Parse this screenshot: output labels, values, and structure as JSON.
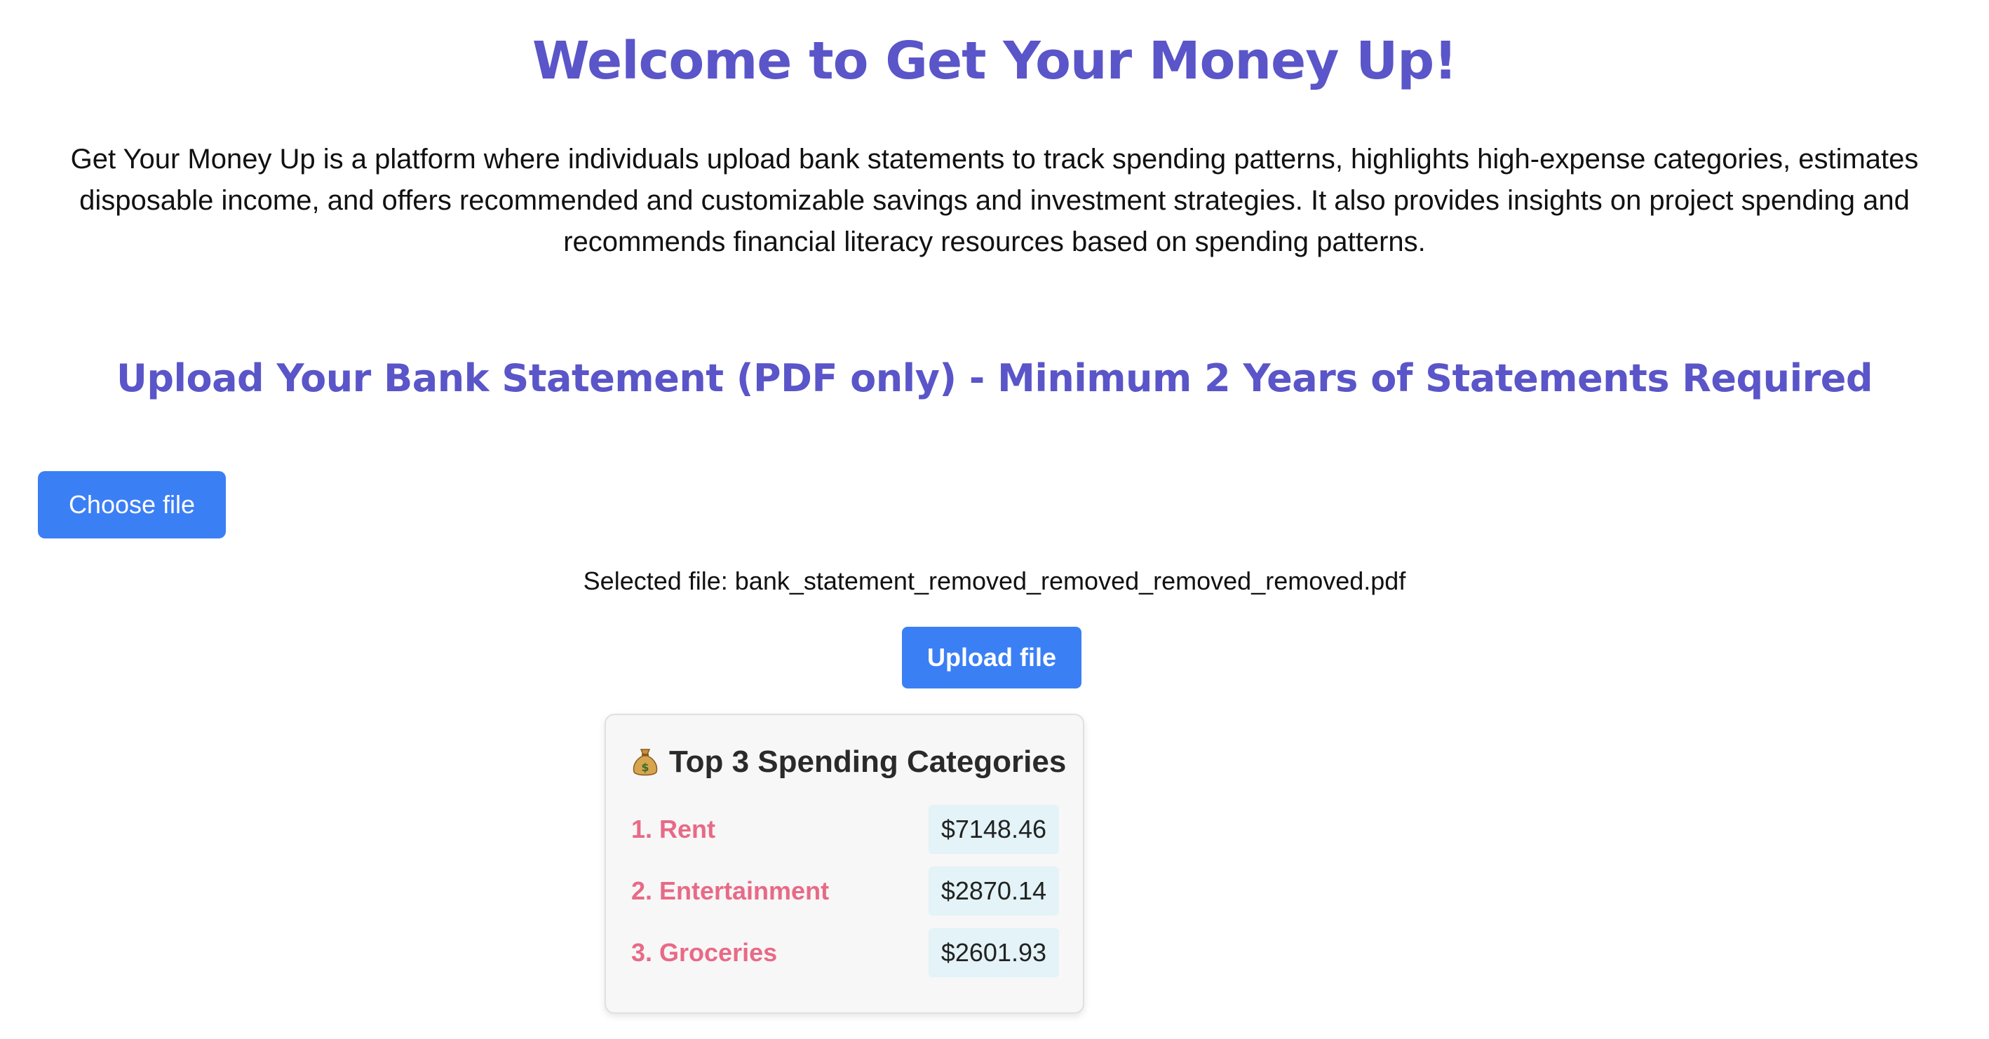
{
  "header": {
    "title": "Welcome to Get Your Money Up!",
    "description": "Get Your Money Up is a platform where individuals upload bank statements to track spending patterns, highlights high-expense categories, estimates disposable income, and offers recommended and customizable savings and investment strategies. It also provides insights on project spending and recommends financial literacy resources based on spending patterns."
  },
  "upload": {
    "heading": "Upload Your Bank Statement (PDF only) - Minimum 2 Years of Statements Required",
    "choose_label": "Choose file",
    "selected_file_text": "Selected file: bank_statement_removed_removed_removed_removed.pdf",
    "upload_label": "Upload file"
  },
  "spending": {
    "icon": "money-bag-icon",
    "title": "Top 3 Spending Categories",
    "items": [
      {
        "label": "1. Rent",
        "amount": "$7148.46"
      },
      {
        "label": "2. Entertainment",
        "amount": "$2870.14"
      },
      {
        "label": "3. Groceries",
        "amount": "$2601.93"
      }
    ]
  },
  "colors": {
    "heading": "#5a55c8",
    "button": "#3b7ff5",
    "category_label": "#e86a86",
    "amount_bg": "#e3f3f7"
  }
}
